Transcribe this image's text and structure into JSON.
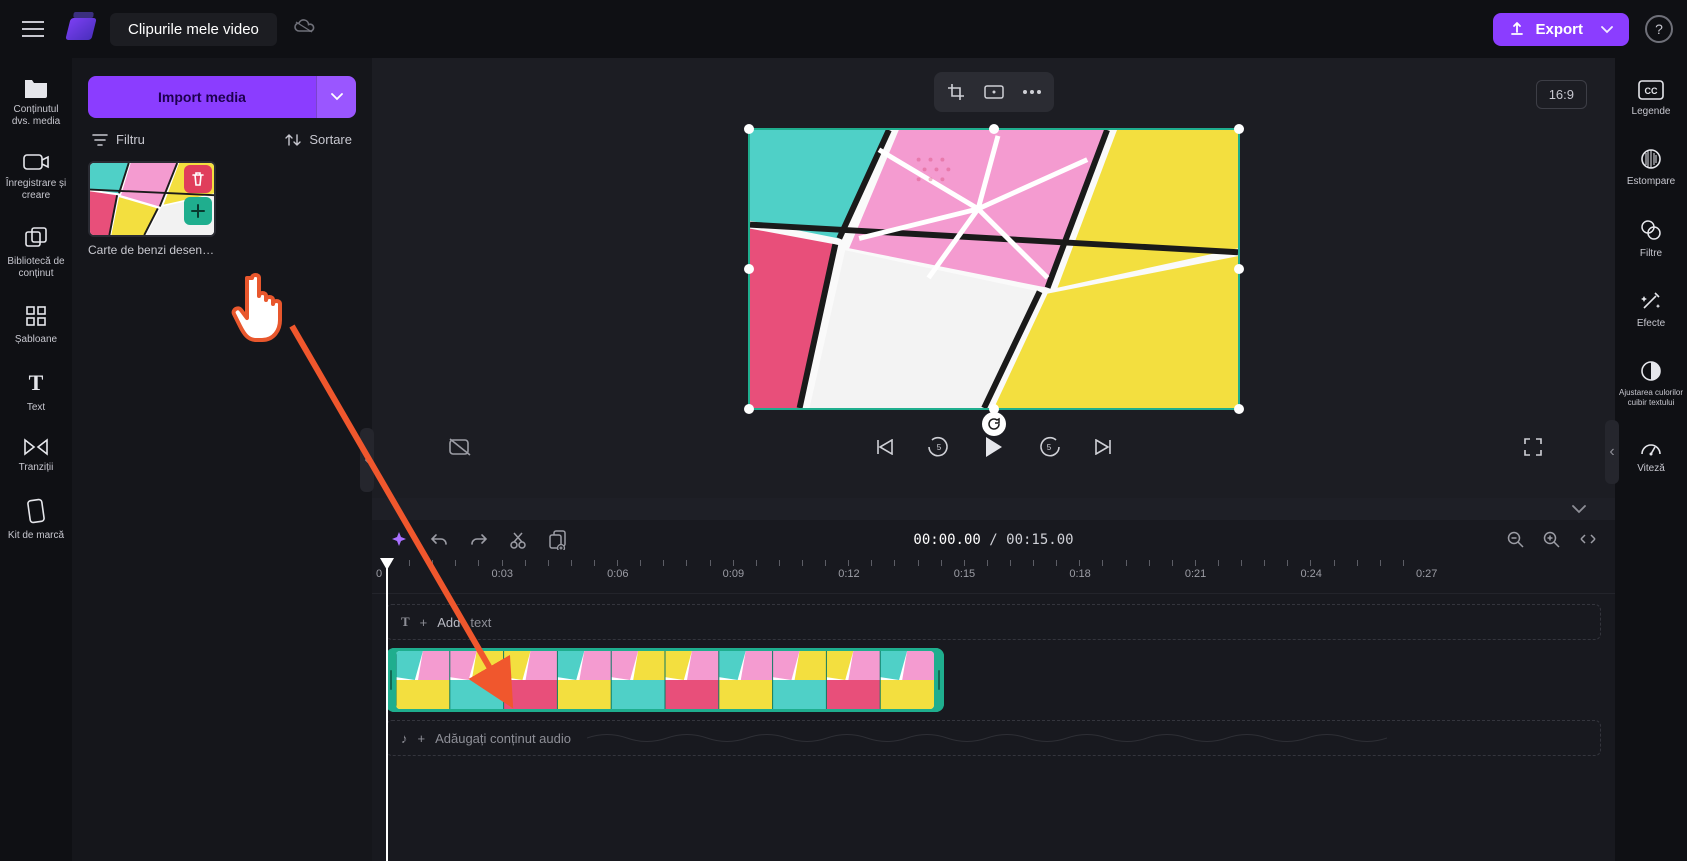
{
  "header": {
    "title": "Clipurile mele video",
    "export_label": "Export",
    "aspect_ratio": "16:9"
  },
  "left_rail": [
    {
      "name": "media",
      "label": "Conținutul dvs. media"
    },
    {
      "name": "record",
      "label": "Înregistrare și creare"
    },
    {
      "name": "library",
      "label": "Bibliotecă de conținut"
    },
    {
      "name": "templates",
      "label": "Șabloane"
    },
    {
      "name": "text",
      "label": "Text"
    },
    {
      "name": "transitions",
      "label": "Tranziții"
    },
    {
      "name": "brandkit",
      "label": "Kit de marcă"
    }
  ],
  "panel": {
    "import_label": "Import media",
    "filter_label": "Filtru",
    "sort_label": "Sortare",
    "media_items": [
      {
        "name": "comic-clip",
        "label": "Carte de benzi desenate"
      }
    ]
  },
  "playback": {
    "current_time": "00:00.00",
    "total_time": "00:15.00"
  },
  "ruler_marks": [
    "0",
    "0:03",
    "0:06",
    "0:09",
    "0:12",
    "0:15",
    "0:18",
    "0:21",
    "0:24",
    "0:27"
  ],
  "tracks": {
    "text_add_label_prefix": "Add",
    "text_add_label_suffix": "text",
    "audio_add_label": "Adăugați conținut audio"
  },
  "right_rail": [
    {
      "name": "captions",
      "label": "Legende"
    },
    {
      "name": "fade",
      "label": "Estompare"
    },
    {
      "name": "filters",
      "label": "Filtre"
    },
    {
      "name": "effects",
      "label": "Efecte"
    },
    {
      "name": "coloradjust",
      "label": "Ajustarea culorilor cuibir textului"
    },
    {
      "name": "speed",
      "label": "Viteză"
    }
  ]
}
